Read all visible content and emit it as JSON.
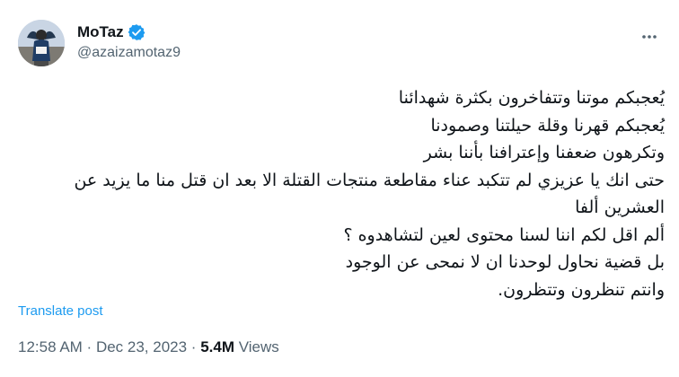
{
  "author": {
    "display_name": "MoTaz",
    "handle": "@azaizamotaz9",
    "verified_icon": "verified-badge-icon"
  },
  "post": {
    "lines": [
      "يُعجبكم موتنا وتتفاخرون بكثرة شهدائنا",
      "يُعجبكم قهرنا وقلة حيلتنا وصمودنا",
      "وتكرهون ضعفنا وإعترافنا بأننا بشر",
      "حتى انك يا عزيزي لم تتكبد عناء مقاطعة منتجات القتلة الا بعد ان قتل منا ما يزيد عن",
      "العشرين ألفا",
      "ألم اقل لكم اننا لسنا محتوى لعين لتشاهدوه ؟",
      "بل قضية نحاول لوحدنا ان لا نمحى عن الوجود",
      "وانتم تنظرون وتتظرون."
    ],
    "translate_label": "Translate post"
  },
  "meta": {
    "time": "12:58 AM",
    "separator": " · ",
    "date": "Dec 23, 2023",
    "views_count": "5.4M",
    "views_label": "Views"
  },
  "colors": {
    "accent": "#1d9bf0",
    "text": "#0f1419",
    "muted": "#536471"
  }
}
